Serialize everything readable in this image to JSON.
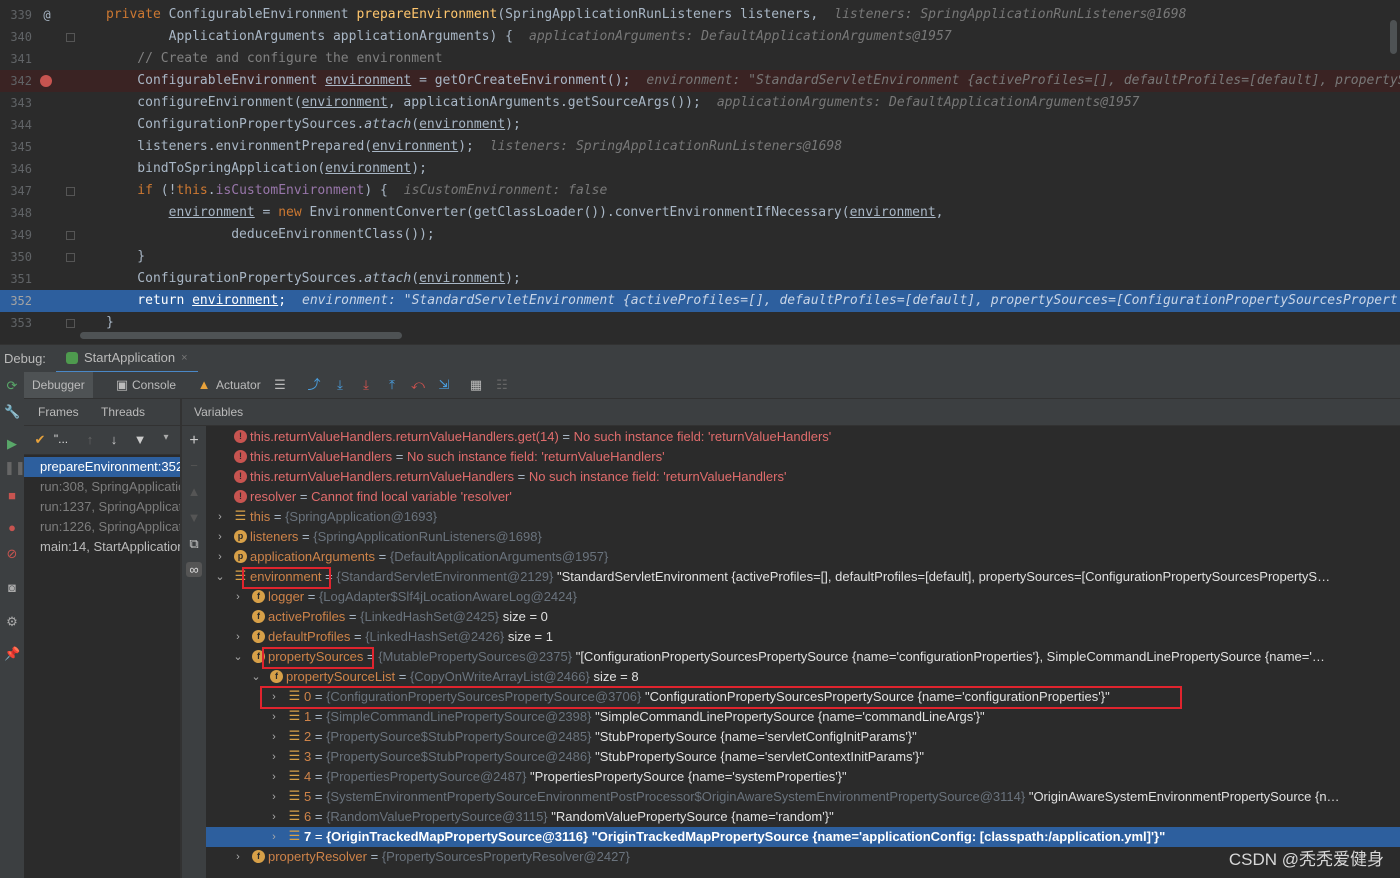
{
  "editor": {
    "lines": [
      {
        "num": "339",
        "gutter": "@",
        "parts": [
          {
            "c": "kw",
            "t": "private "
          },
          {
            "c": "",
            "t": "ConfigurableEnvironment "
          },
          {
            "c": "fn",
            "t": "prepareEnvironment"
          },
          {
            "c": "",
            "t": "(SpringApplicationRunListeners listeners,"
          }
        ],
        "hint": "listeners: SpringApplicationRunListeners@1698"
      },
      {
        "num": "340",
        "gutter": "",
        "parts": [
          {
            "c": "",
            "t": "        ApplicationArguments applicationArguments) {"
          }
        ],
        "hint": "applicationArguments: DefaultApplicationArguments@1957"
      },
      {
        "num": "341",
        "gutter": "",
        "parts": [
          {
            "c": "cm",
            "t": "    // Create and configure the environment"
          }
        ],
        "hint": ""
      },
      {
        "num": "342",
        "gutter": "bp",
        "parts": [
          {
            "c": "",
            "t": "    ConfigurableEnvironment "
          },
          {
            "c": "ul",
            "t": "environment"
          },
          {
            "c": "",
            "t": " = getOrCreateEnvironment();"
          }
        ],
        "hint": "environment: \"StandardServletEnvironment {activeProfiles=[], defaultProfiles=[default], propertyS"
      },
      {
        "num": "343",
        "gutter": "",
        "parts": [
          {
            "c": "",
            "t": "    configureEnvironment("
          },
          {
            "c": "ul",
            "t": "environment"
          },
          {
            "c": "",
            "t": ", applicationArguments.getSourceArgs());"
          }
        ],
        "hint": "applicationArguments: DefaultApplicationArguments@1957"
      },
      {
        "num": "344",
        "gutter": "",
        "parts": [
          {
            "c": "",
            "t": "    ConfigurationPropertySources."
          },
          {
            "c": "it",
            "t": "attach"
          },
          {
            "c": "",
            "t": "("
          },
          {
            "c": "ul",
            "t": "environment"
          },
          {
            "c": "",
            "t": ");"
          }
        ],
        "hint": ""
      },
      {
        "num": "345",
        "gutter": "",
        "parts": [
          {
            "c": "",
            "t": "    listeners.environmentPrepared("
          },
          {
            "c": "ul",
            "t": "environment"
          },
          {
            "c": "",
            "t": ");"
          }
        ],
        "hint": "listeners: SpringApplicationRunListeners@1698"
      },
      {
        "num": "346",
        "gutter": "",
        "parts": [
          {
            "c": "",
            "t": "    bindToSpringApplication("
          },
          {
            "c": "ul",
            "t": "environment"
          },
          {
            "c": "",
            "t": ");"
          }
        ],
        "hint": ""
      },
      {
        "num": "347",
        "gutter": "",
        "parts": [
          {
            "c": "kw",
            "t": "    if "
          },
          {
            "c": "",
            "t": "(!"
          },
          {
            "c": "kw",
            "t": "this"
          },
          {
            "c": "",
            "t": "."
          },
          {
            "c": "st",
            "t": "isCustomEnvironment"
          },
          {
            "c": "",
            "t": ") {"
          }
        ],
        "hint": "isCustomEnvironment: false"
      },
      {
        "num": "348",
        "gutter": "",
        "parts": [
          {
            "c": "",
            "t": "        "
          },
          {
            "c": "ul",
            "t": "environment"
          },
          {
            "c": "",
            "t": " = "
          },
          {
            "c": "kw",
            "t": "new "
          },
          {
            "c": "",
            "t": "EnvironmentConverter(getClassLoader()).convertEnvironmentIfNecessary("
          },
          {
            "c": "ul",
            "t": "environment"
          },
          {
            "c": "",
            "t": ","
          }
        ],
        "hint": ""
      },
      {
        "num": "349",
        "gutter": "",
        "parts": [
          {
            "c": "",
            "t": "                deduceEnvironmentClass());"
          }
        ],
        "hint": ""
      },
      {
        "num": "350",
        "gutter": "",
        "parts": [
          {
            "c": "",
            "t": "    }"
          }
        ],
        "hint": ""
      },
      {
        "num": "351",
        "gutter": "",
        "parts": [
          {
            "c": "",
            "t": "    ConfigurationPropertySources."
          },
          {
            "c": "it",
            "t": "attach"
          },
          {
            "c": "",
            "t": "("
          },
          {
            "c": "ul",
            "t": "environment"
          },
          {
            "c": "",
            "t": ");"
          }
        ],
        "hint": ""
      },
      {
        "num": "352",
        "gutter": "",
        "parts": [
          {
            "c": "kw",
            "t": "    return "
          },
          {
            "c": "ul",
            "t": "environment"
          },
          {
            "c": "",
            "t": ";"
          }
        ],
        "hint": "environment: \"StandardServletEnvironment {activeProfiles=[], defaultProfiles=[default], propertySources=[ConfigurationPropertySourcesPropert"
      },
      {
        "num": "353",
        "gutter": "",
        "parts": [
          {
            "c": "",
            "t": "}"
          }
        ],
        "hint": ""
      }
    ]
  },
  "debugbar": {
    "label": "Debug:",
    "tab": "StartApplication",
    "tab_close": "×"
  },
  "toolbar": {
    "debugger": "Debugger",
    "console": "Console",
    "actuator": "Actuator"
  },
  "frames_pane": {
    "frames_label": "Frames",
    "threads_label": "Threads",
    "thread_select": "\"..."
  },
  "frames": [
    {
      "label": "prepareEnvironment:352",
      "state": "sel"
    },
    {
      "label": "run:308, SpringApplication",
      "state": ""
    },
    {
      "label": "run:1237, SpringApplication",
      "state": ""
    },
    {
      "label": "run:1226, SpringApplication",
      "state": ""
    },
    {
      "label": "main:14, StartApplication",
      "state": "main"
    }
  ],
  "variables_label": "Variables",
  "variables": [
    {
      "depth": 0,
      "arrow": "",
      "icon": "err",
      "name": "this.returnValueHandlers.returnValueHandlers.get(14)",
      "type": "",
      "value": "No such instance field: 'returnValueHandlers'",
      "kind": "err"
    },
    {
      "depth": 0,
      "arrow": "",
      "icon": "err",
      "name": "this.returnValueHandlers",
      "type": "",
      "value": "No such instance field: 'returnValueHandlers'",
      "kind": "err"
    },
    {
      "depth": 0,
      "arrow": "",
      "icon": "err",
      "name": "this.returnValueHandlers.returnValueHandlers",
      "type": "",
      "value": "No such instance field: 'returnValueHandlers'",
      "kind": "err"
    },
    {
      "depth": 0,
      "arrow": "",
      "icon": "err",
      "name": "resolver",
      "type": "",
      "value": "Cannot find local variable 'resolver'",
      "kind": "err"
    },
    {
      "depth": 0,
      "arrow": ">",
      "icon": "lst",
      "name": "this",
      "type": "{SpringApplication@1693}",
      "value": "",
      "kind": ""
    },
    {
      "depth": 0,
      "arrow": ">",
      "icon": "p",
      "name": "listeners",
      "type": "{SpringApplicationRunListeners@1698}",
      "value": "",
      "kind": ""
    },
    {
      "depth": 0,
      "arrow": ">",
      "icon": "p",
      "name": "applicationArguments",
      "type": "{DefaultApplicationArguments@1957}",
      "value": "",
      "kind": ""
    },
    {
      "depth": 0,
      "arrow": "v",
      "icon": "lst",
      "name": "environment",
      "type": "{StandardServletEnvironment@2129}",
      "value": "\"StandardServletEnvironment {activeProfiles=[], defaultProfiles=[default], propertySources=[ConfigurationPropertySourcesPropertyS…",
      "kind": ""
    },
    {
      "depth": 1,
      "arrow": ">",
      "icon": "f",
      "name": "logger",
      "type": "{LogAdapter$Slf4jLocationAwareLog@2424}",
      "value": "",
      "kind": ""
    },
    {
      "depth": 1,
      "arrow": "",
      "icon": "f",
      "name": "activeProfiles",
      "type": "{LinkedHashSet@2425}",
      "value": " size = 0",
      "kind": ""
    },
    {
      "depth": 1,
      "arrow": ">",
      "icon": "f",
      "name": "defaultProfiles",
      "type": "{LinkedHashSet@2426}",
      "value": " size = 1",
      "kind": ""
    },
    {
      "depth": 1,
      "arrow": "v",
      "icon": "f",
      "name": "propertySources",
      "type": "{MutablePropertySources@2375}",
      "value": "\"[ConfigurationPropertySourcesPropertySource {name='configurationProperties'}, SimpleCommandLinePropertySource {name='…",
      "kind": ""
    },
    {
      "depth": 2,
      "arrow": "v",
      "icon": "f",
      "name": "propertySourceList",
      "type": "{CopyOnWriteArrayList@2466}",
      "value": " size = 8",
      "kind": ""
    },
    {
      "depth": 3,
      "arrow": ">",
      "icon": "lst",
      "name": "0",
      "type": "{ConfigurationPropertySourcesPropertySource@3706}",
      "value": "\"ConfigurationPropertySourcesPropertySource {name='configurationProperties'}\"",
      "kind": ""
    },
    {
      "depth": 3,
      "arrow": ">",
      "icon": "lst",
      "name": "1",
      "type": "{SimpleCommandLinePropertySource@2398}",
      "value": "\"SimpleCommandLinePropertySource {name='commandLineArgs'}\"",
      "kind": ""
    },
    {
      "depth": 3,
      "arrow": ">",
      "icon": "lst",
      "name": "2",
      "type": "{PropertySource$StubPropertySource@2485}",
      "value": "\"StubPropertySource {name='servletConfigInitParams'}\"",
      "kind": ""
    },
    {
      "depth": 3,
      "arrow": ">",
      "icon": "lst",
      "name": "3",
      "type": "{PropertySource$StubPropertySource@2486}",
      "value": "\"StubPropertySource {name='servletContextInitParams'}\"",
      "kind": ""
    },
    {
      "depth": 3,
      "arrow": ">",
      "icon": "lst",
      "name": "4",
      "type": "{PropertiesPropertySource@2487}",
      "value": "\"PropertiesPropertySource {name='systemProperties'}\"",
      "kind": ""
    },
    {
      "depth": 3,
      "arrow": ">",
      "icon": "lst",
      "name": "5",
      "type": "{SystemEnvironmentPropertySourceEnvironmentPostProcessor$OriginAwareSystemEnvironmentPropertySource@3114}",
      "value": "\"OriginAwareSystemEnvironmentPropertySource {n…",
      "kind": ""
    },
    {
      "depth": 3,
      "arrow": ">",
      "icon": "lst",
      "name": "6",
      "type": "{RandomValuePropertySource@3115}",
      "value": "\"RandomValuePropertySource {name='random'}\"",
      "kind": ""
    },
    {
      "depth": 3,
      "arrow": ">",
      "icon": "lst",
      "name": "7",
      "type": "{OriginTrackedMapPropertySource@3116}",
      "value": "\"OriginTrackedMapPropertySource {name='applicationConfig: [classpath:/application.yml]'}\"",
      "kind": "sel"
    },
    {
      "depth": 1,
      "arrow": ">",
      "icon": "f",
      "name": "propertyResolver",
      "type": "{PropertySourcesPropertyResolver@2427}",
      "value": "",
      "kind": ""
    }
  ],
  "watermark": "CSDN @秃秃爱健身",
  "colors": {
    "selection": "#2d5f9e",
    "highlight_box": "#e0242e",
    "error_text": "#e06c6c",
    "keyword": "#cc7832",
    "method": "#ffc66d"
  }
}
